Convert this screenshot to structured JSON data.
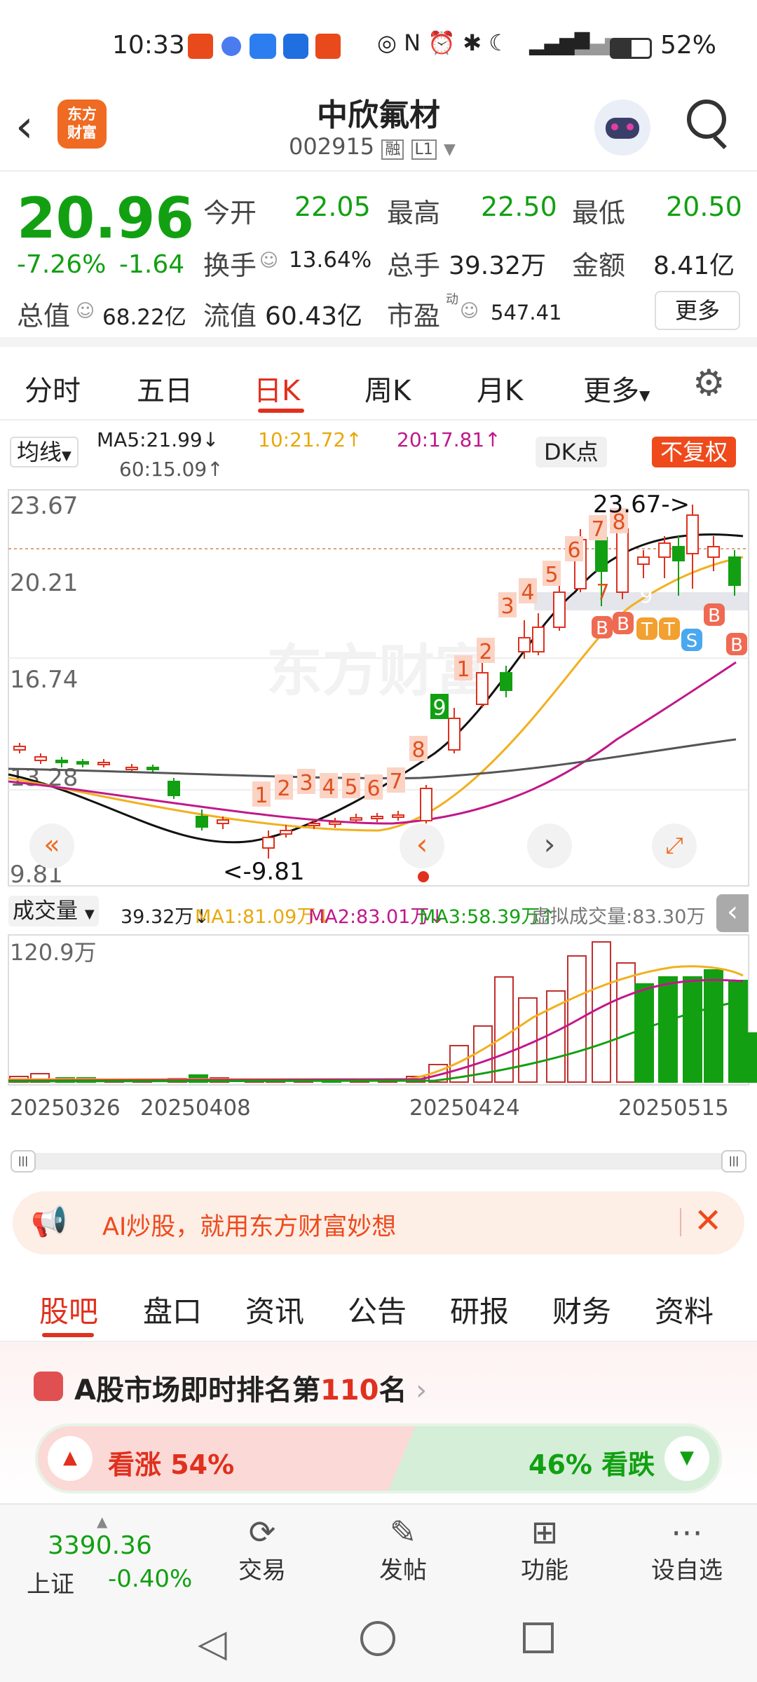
{
  "status": {
    "time": "10:33",
    "icons_left": [
      "taobao-app-icon",
      "music-app-icon",
      "car-app-icon",
      "bolt-app-icon",
      "taobao-app-icon"
    ],
    "network": "4G",
    "battery": "52%"
  },
  "header": {
    "logo_line1": "东方",
    "logo_line2": "财富",
    "stock_name": "中欣氟材",
    "stock_code": "002915",
    "tag_rong": "融",
    "tag_level": "L1"
  },
  "quote": {
    "price": "20.96",
    "change_pct": "-7.26%",
    "change": "-1.64",
    "fields": [
      {
        "label": "今开",
        "value": "22.05"
      },
      {
        "label": "最高",
        "value": "22.50"
      },
      {
        "label": "最低",
        "value": "20.50"
      },
      {
        "label": "换手",
        "value": "13.64%"
      },
      {
        "label": "总手",
        "value": "39.32万"
      },
      {
        "label": "金额",
        "value": "8.41亿"
      },
      {
        "label": "总值",
        "value": "68.22亿"
      },
      {
        "label": "流值",
        "value": "60.43亿"
      },
      {
        "label": "市盈",
        "value": "547.41"
      }
    ],
    "pe_sup": "动",
    "more": "更多"
  },
  "tabs": [
    "分时",
    "五日",
    "日K",
    "周K",
    "月K",
    "更多"
  ],
  "ma": {
    "type": "均线",
    "ma5": "MA5:21.99↓",
    "ma10": "10:21.72↑",
    "ma20": "20:17.81↑",
    "ma60": "60:15.09↑",
    "dk": "DK点",
    "fq": "不复权"
  },
  "chart_data": {
    "type": "candlestick",
    "y_labels": [
      "23.67",
      "20.21",
      "16.74",
      "13.28",
      "9.81"
    ],
    "high_label": "23.67->",
    "low_label": "<-9.81",
    "watermark": "东方财富",
    "td_numbers_up": [
      "1",
      "2",
      "3",
      "4",
      "5",
      "6",
      "7",
      "8",
      "9",
      "1",
      "2",
      "3",
      "4",
      "5",
      "6",
      "7",
      "8"
    ],
    "td_numbers_down": [
      "7",
      "9"
    ],
    "bs_markers": [
      "B",
      "B",
      "T",
      "T",
      "S",
      "B",
      "B"
    ]
  },
  "volume": {
    "label": "成交量",
    "vol": "39.32万↓",
    "ma1": "MA1:81.09万↓",
    "ma2": "MA2:83.01万↓",
    "ma3": "MA3:58.39万↑",
    "virtual": "虚拟成交量:83.30万",
    "max": "120.9万"
  },
  "dates": [
    "20250326",
    "20250408",
    "20250424",
    "20250515"
  ],
  "banner": {
    "text": "AI炒股，就用东方财富妙想"
  },
  "subtabs": [
    "股吧",
    "盘口",
    "资讯",
    "公告",
    "研报",
    "财务",
    "资料"
  ],
  "rank": {
    "prefix": "A股市场即时排名第",
    "num": "110",
    "suffix": "名",
    "bull": "看涨 54%",
    "bear": "46% 看跌"
  },
  "bottom": {
    "index_value": "3390.36",
    "index_name": "上证",
    "index_change": "-0.40%",
    "items": [
      "交易",
      "发帖",
      "功能",
      "设自选"
    ]
  }
}
